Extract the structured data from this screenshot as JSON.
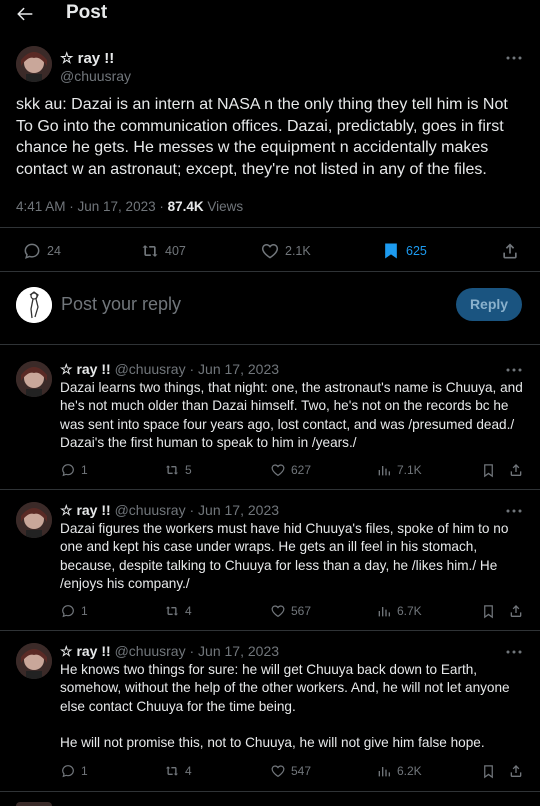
{
  "header": {
    "title": "Post"
  },
  "post": {
    "author": "☆ ray !!",
    "handle": "@chuusray",
    "text": "skk au: Dazai is an intern at NASA n the only thing they tell him is Not To Go into the communication offices. Dazai, predictably, goes in first chance he gets. He messes w the equipment n accidentally makes contact w an astronaut; except, they're not listed in any of the files.",
    "time": "4:41 AM · Jun 17, 2023 ·",
    "views_count": "87.4K",
    "views_label": "Views",
    "replies": "24",
    "reposts": "407",
    "likes": "2.1K",
    "bookmarks": "625",
    "bookmark_color": "#1d9bf0"
  },
  "compose": {
    "placeholder": "Post your reply",
    "button": "Reply"
  },
  "replies": [
    {
      "author": "☆ ray !!",
      "handle": "@chuusray",
      "date": "· Jun 17, 2023",
      "text": "Dazai learns two things, that night: one, the astronaut's name is Chuuya, and he's not much older than Dazai himself. Two, he's not on the records bc he was sent into space four years ago, lost contact, and was /presumed dead./ Dazai's the first human to speak to him in /years./",
      "replies": "1",
      "reposts": "5",
      "likes": "627",
      "views": "7.1K"
    },
    {
      "author": "☆ ray !!",
      "handle": "@chuusray",
      "date": "· Jun 17, 2023",
      "text": "Dazai figures the workers must have hid Chuuya's files, spoke of him to no one and kept his case under wraps. He gets an ill feel in his stomach, because, despite talking to Chuuya for less than a day, he /likes him./ He /enjoys his company./",
      "replies": "1",
      "reposts": "4",
      "likes": "567",
      "views": "6.7K"
    },
    {
      "author": "☆ ray !!",
      "handle": "@chuusray",
      "date": "· Jun 17, 2023",
      "text": "He knows two things for sure: he will get Chuuya back down to Earth, somehow, without the help of the other workers. And, he will not let anyone else contact Chuuya for the time being.",
      "text2": "He will not promise this, not to Chuuya, he will not give him false hope.",
      "replies": "1",
      "reposts": "4",
      "likes": "547",
      "views": "6.2K"
    }
  ]
}
